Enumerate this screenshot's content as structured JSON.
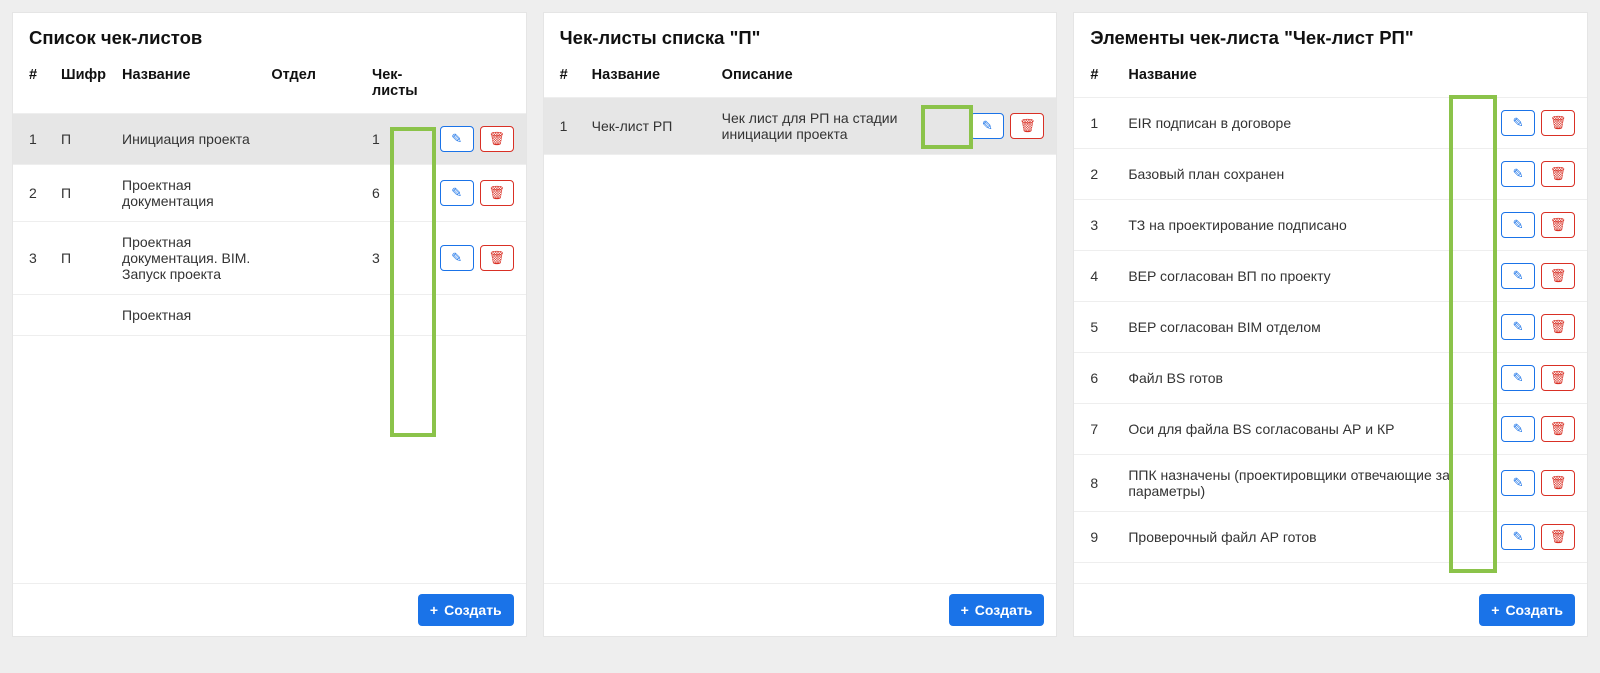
{
  "panel1": {
    "title": "Список чек-листов",
    "headers": {
      "num": "#",
      "code": "Шифр",
      "name": "Название",
      "dept": "Отдел",
      "checklists": "Чек-листы"
    },
    "rows": [
      {
        "num": "1",
        "code": "П",
        "name": "Инициация проекта",
        "dept": "",
        "cl": "1",
        "selected": true
      },
      {
        "num": "2",
        "code": "П",
        "name": "Проектная документация",
        "dept": "",
        "cl": "6",
        "selected": false
      },
      {
        "num": "3",
        "code": "П",
        "name": "Проектная документация. BIM. Запуск проекта",
        "dept": "",
        "cl": "3",
        "selected": false
      },
      {
        "num": "",
        "code": "",
        "name": "Проектная",
        "dept": "",
        "cl": "",
        "selected": false
      }
    ],
    "create": "Создать"
  },
  "panel2": {
    "title": "Чек-листы списка \"П\"",
    "headers": {
      "num": "#",
      "name": "Название",
      "desc": "Описание"
    },
    "rows": [
      {
        "num": "1",
        "name": "Чек-лист РП",
        "desc": "Чек лист для РП на стадии инициации проекта",
        "selected": true
      }
    ],
    "create": "Создать"
  },
  "panel3": {
    "title": "Элементы чек-листа \"Чек-лист РП\"",
    "headers": {
      "num": "#",
      "name": "Название"
    },
    "rows": [
      {
        "num": "1",
        "name": "EIR подписан в  договоре"
      },
      {
        "num": "2",
        "name": "Базовый план сохранен"
      },
      {
        "num": "3",
        "name": "ТЗ на проектирование подписано"
      },
      {
        "num": "4",
        "name": "BEP согласован ВП по проекту"
      },
      {
        "num": "5",
        "name": "BEP согласован BIM отделом"
      },
      {
        "num": "6",
        "name": "Файл BS готов"
      },
      {
        "num": "7",
        "name": "Оси для файла BS согласованы АР и КР"
      },
      {
        "num": "8",
        "name": "ППК назначены (проектировщики отвечающие за параметры)"
      },
      {
        "num": "9",
        "name": "Проверочный файл АР готов"
      }
    ],
    "create": "Создать"
  }
}
